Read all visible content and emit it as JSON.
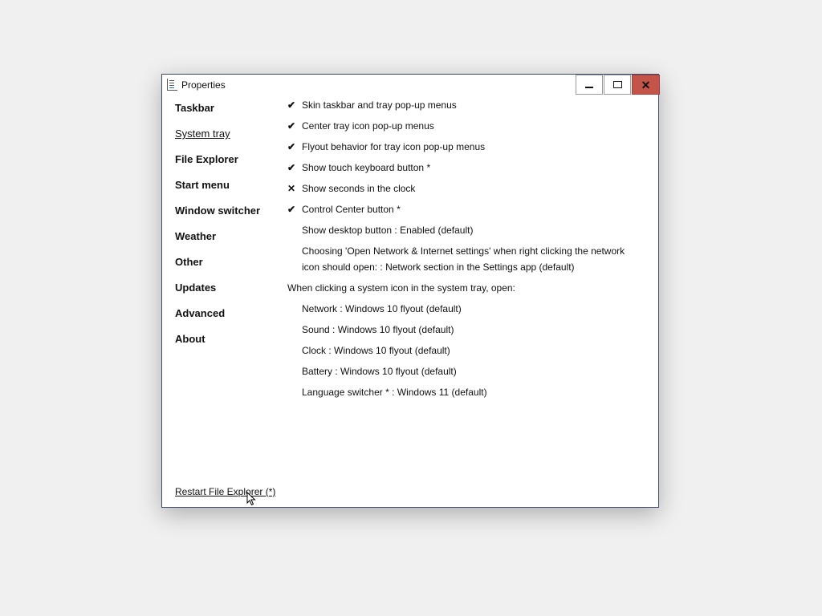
{
  "window": {
    "title": "Properties",
    "minimize_icon": "minimize-icon",
    "maximize_icon": "maximize-icon",
    "close_icon": "close-icon",
    "close_color": "#c4544a"
  },
  "sidebar": {
    "items": [
      {
        "label": "Taskbar"
      },
      {
        "label": "System tray"
      },
      {
        "label": "File Explorer"
      },
      {
        "label": "Start menu"
      },
      {
        "label": "Window switcher"
      },
      {
        "label": "Weather"
      },
      {
        "label": "Other"
      },
      {
        "label": "Updates"
      },
      {
        "label": "Advanced"
      },
      {
        "label": "About"
      }
    ],
    "active": "System tray"
  },
  "settings": {
    "toggles": [
      {
        "mark": "✔",
        "label": "Skin taskbar and tray pop-up menus"
      },
      {
        "mark": "✔",
        "label": "Center tray icon pop-up menus"
      },
      {
        "mark": "✔",
        "label": "Flyout behavior for tray icon pop-up menus"
      },
      {
        "mark": "✔",
        "label": "Show touch keyboard button *"
      },
      {
        "mark": "✕",
        "label": "Show seconds in the clock"
      },
      {
        "mark": "✔",
        "label": "Control Center button *"
      }
    ],
    "show_desktop": "Show desktop button : Enabled (default)",
    "network_setting": "Choosing 'Open Network & Internet settings' when right clicking the network icon should open: : Network section in the Settings app (default)",
    "system_icon_heading": "When clicking a system icon in the system tray, open:",
    "system_icons": [
      {
        "label": "Network : Windows 10 flyout (default)"
      },
      {
        "label": "Sound : Windows 10 flyout (default)"
      },
      {
        "label": "Clock : Windows 10 flyout (default)"
      },
      {
        "label": "Battery : Windows 10 flyout (default)"
      },
      {
        "label": "Language switcher * : Windows 11 (default)"
      }
    ]
  },
  "footer": {
    "restart_label": "Restart File Explorer (*)"
  }
}
